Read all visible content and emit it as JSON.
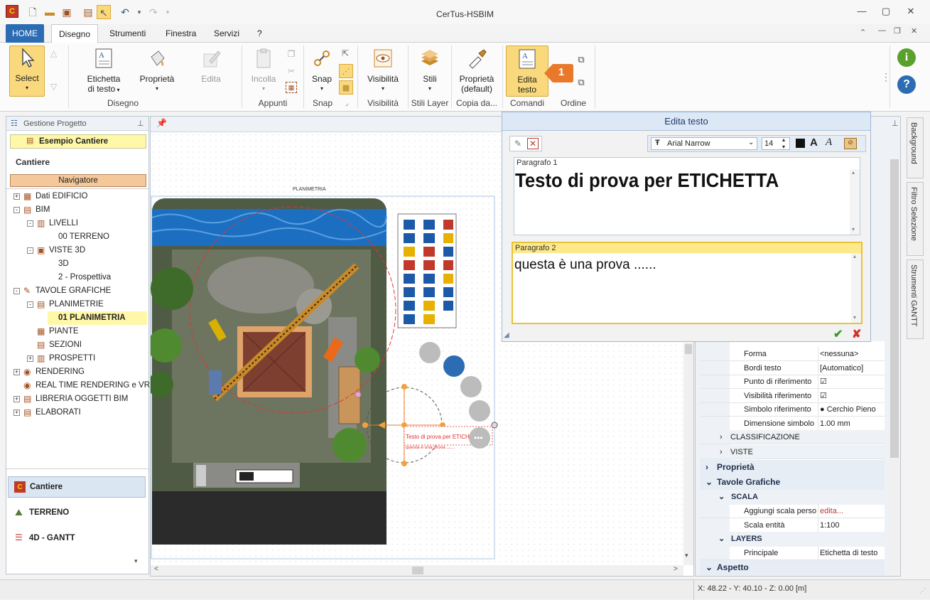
{
  "app_title": "CerTus-HSBIM",
  "tabs": [
    "HOME",
    "Disegno",
    "Strumenti",
    "Finestra",
    "Servizi",
    "?"
  ],
  "ribbon": {
    "select": "Select",
    "etichetta": "Etichetta\ndi testo",
    "proprieta": "Proprietà",
    "edita": "Edita",
    "incolla": "Incolla",
    "snap": "Snap",
    "visibilita": "Visibilità",
    "stili": "Stili",
    "proprieta_default": "Proprietà\n(default)",
    "edita_testo": "Edita\ntesto",
    "callout_number": "1",
    "groups": [
      "Disegno",
      "Appunti",
      "Snap",
      "Visibilità",
      "Stili Layer",
      "Copia da...",
      "Comandi",
      "Ordine"
    ]
  },
  "left_panel": {
    "header": "Gestione Progetto",
    "project": "Esempio Cantiere",
    "section": "Cantiere",
    "navigator": "Navigatore",
    "tree": [
      {
        "label": "Dati EDIFICIO",
        "level": 0,
        "exp": "+"
      },
      {
        "label": "BIM",
        "level": 0,
        "exp": "-"
      },
      {
        "label": "LIVELLI",
        "level": 1,
        "exp": "-"
      },
      {
        "label": "00 TERRENO",
        "level": 2,
        "exp": ""
      },
      {
        "label": "VISTE 3D",
        "level": 1,
        "exp": "-"
      },
      {
        "label": "3D",
        "level": 2,
        "exp": ""
      },
      {
        "label": "2 - Prospettiva",
        "level": 2,
        "exp": ""
      },
      {
        "label": "TAVOLE GRAFICHE",
        "level": 0,
        "exp": "-"
      },
      {
        "label": "PLANIMETRIE",
        "level": 1,
        "exp": "-"
      },
      {
        "label": "01 PLANIMETRIA",
        "level": 2,
        "exp": "",
        "selected": true
      },
      {
        "label": "PIANTE",
        "level": 1,
        "exp": ""
      },
      {
        "label": "SEZIONI",
        "level": 1,
        "exp": ""
      },
      {
        "label": "PROSPETTI",
        "level": 1,
        "exp": "+"
      },
      {
        "label": "RENDERING",
        "level": 0,
        "exp": "+"
      },
      {
        "label": "REAL TIME RENDERING e VRI",
        "level": 0,
        "exp": ""
      },
      {
        "label": "LIBRERIA OGGETTI BIM",
        "level": 0,
        "exp": "+"
      },
      {
        "label": "ELABORATI",
        "level": 0,
        "exp": "+"
      }
    ],
    "bottom": [
      "Cantiere",
      "TERRENO",
      "4D - GANTT"
    ]
  },
  "canvas": {
    "plan_title": "PLANIMETRIA",
    "label_line1": "Testo di prova per ETICH",
    "label_line2": "questa è una prova ......"
  },
  "dialog": {
    "title": "Edita testo",
    "font": "Arial Narrow",
    "size": "14",
    "p1_label": "Paragrafo 1",
    "p1_text": "Testo di prova per ETICHETTA",
    "p2_label": "Paragrafo 2",
    "p2_text": "questa è una prova ......"
  },
  "properties": {
    "rows": [
      {
        "key": "Forma",
        "val": "<nessuna>"
      },
      {
        "key": "Bordi testo",
        "val": "[Automatico]"
      },
      {
        "key": "Punto di riferimento",
        "val": "☑"
      },
      {
        "key": "Visibilità riferimento",
        "val": "☑"
      },
      {
        "key": "Simbolo riferimento",
        "val": "● Cerchio Pieno"
      },
      {
        "key": "Dimensione simbolo",
        "val": "1.00 mm"
      }
    ],
    "sub_classificazione": "CLASSIFICAZIONE",
    "sub_viste": "VISTE",
    "sec_proprieta": "Proprietà",
    "sec_tavole": "Tavole Grafiche",
    "sub_scala": "SCALA",
    "scala_rows": [
      {
        "key": "Aggiungi scala personalizzata",
        "val": "edita..."
      },
      {
        "key": "Scala entità",
        "val": "1:100"
      }
    ],
    "sub_layers": "LAYERS",
    "layer_rows": [
      {
        "key": "Principale",
        "val": "Etichetta di testo"
      }
    ],
    "sec_aspetto": "Aspetto"
  },
  "side_tabs": [
    "Background",
    "Filtro Selezione",
    "Strumenti GANTT"
  ],
  "status": "X: 48.22 - Y: 40.10 - Z: 0.00 [m]",
  "colors": {
    "accent": "#2b6cb3",
    "highlight": "#fde98a",
    "selected_btn": "#f9d97c"
  }
}
